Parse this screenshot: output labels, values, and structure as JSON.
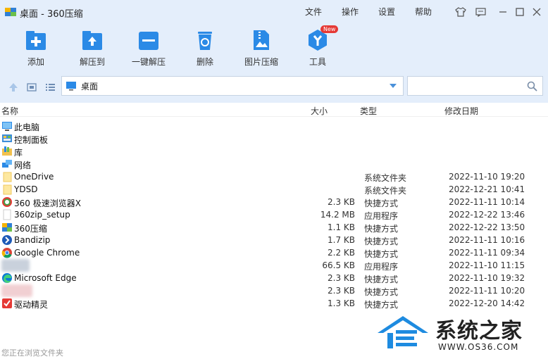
{
  "window": {
    "title": "桌面 - 360压缩",
    "menu": [
      "文件",
      "操作",
      "设置",
      "帮助"
    ]
  },
  "toolbar": {
    "items": [
      {
        "label": "添加",
        "icon": "add-archive-icon"
      },
      {
        "label": "解压到",
        "icon": "extract-to-icon"
      },
      {
        "label": "一键解压",
        "icon": "one-click-extract-icon"
      },
      {
        "label": "删除",
        "icon": "recycle-bin-icon"
      },
      {
        "label": "图片压缩",
        "icon": "image-compress-icon"
      },
      {
        "label": "工具",
        "icon": "tools-icon",
        "badge": "New"
      }
    ]
  },
  "address": {
    "path": "桌面",
    "search_placeholder": ""
  },
  "columns": {
    "name": "名称",
    "size": "大小",
    "type": "类型",
    "modified": "修改日期"
  },
  "files": [
    {
      "name": "此电脑",
      "size": "",
      "type": "",
      "modified": "",
      "icon": "computer-icon"
    },
    {
      "name": "控制面板",
      "size": "",
      "type": "",
      "modified": "",
      "icon": "control-panel-icon"
    },
    {
      "name": "库",
      "size": "",
      "type": "",
      "modified": "",
      "icon": "library-icon"
    },
    {
      "name": "网络",
      "size": "",
      "type": "",
      "modified": "",
      "icon": "network-icon"
    },
    {
      "name": "OneDrive",
      "size": "",
      "type": "系统文件夹",
      "modified": "2022-11-10 19:20",
      "icon": "folder-icon"
    },
    {
      "name": "YDSD",
      "size": "",
      "type": "系统文件夹",
      "modified": "2022-12-21 10:41",
      "icon": "folder-icon"
    },
    {
      "name": "360 极速浏览器X",
      "size": "2.3 KB",
      "type": "快捷方式",
      "modified": "2022-11-11 10:14",
      "icon": "360-browser-icon"
    },
    {
      "name": "360zip_setup",
      "size": "14.2 MB",
      "type": "应用程序",
      "modified": "2022-12-22 13:46",
      "icon": "installer-icon"
    },
    {
      "name": "360压缩",
      "size": "1.1 KB",
      "type": "快捷方式",
      "modified": "2022-12-22 13:50",
      "icon": "360zip-icon"
    },
    {
      "name": "Bandizip",
      "size": "1.7 KB",
      "type": "快捷方式",
      "modified": "2022-11-11 10:16",
      "icon": "bandizip-icon"
    },
    {
      "name": "Google Chrome",
      "size": "2.2 KB",
      "type": "快捷方式",
      "modified": "2022-11-11 09:34",
      "icon": "chrome-icon"
    },
    {
      "name": "",
      "size": "66.5 KB",
      "type": "应用程序",
      "modified": "2022-11-10 11:15",
      "icon": "blurred-icon"
    },
    {
      "name": "Microsoft Edge",
      "size": "2.3 KB",
      "type": "快捷方式",
      "modified": "2022-11-10 19:32",
      "icon": "edge-icon"
    },
    {
      "name": "",
      "size": "2.3 KB",
      "type": "快捷方式",
      "modified": "2022-11-11 10:20",
      "icon": "blurred-icon"
    },
    {
      "name": "驱动精灵",
      "size": "1.3 KB",
      "type": "快捷方式",
      "modified": "2022-12-20 14:42",
      "icon": "driver-genius-icon"
    }
  ],
  "status": {
    "text": "您正在浏览文件夹"
  },
  "watermark": {
    "text": "系统之家",
    "url": "WWW.OS36.COM"
  },
  "colors": {
    "chrome": "#e4eefb",
    "accent": "#1e8be0"
  }
}
